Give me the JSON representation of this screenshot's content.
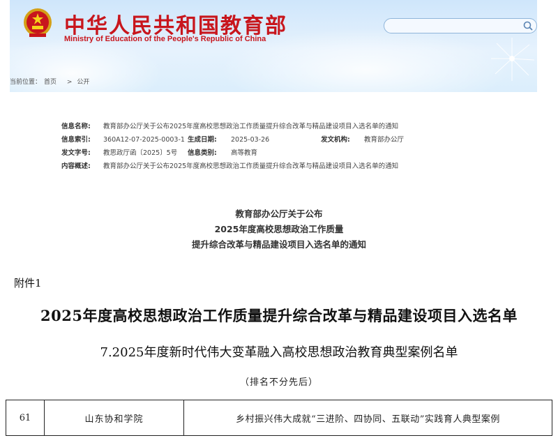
{
  "header": {
    "title": "中华人民共和国教育部",
    "subtitle": "Ministry of Education of the People's Republic of China",
    "search_placeholder": "",
    "breadcrumb": [
      "当前位置：",
      "首页",
      ">",
      "公开"
    ]
  },
  "info": {
    "name_label": "信息名称:",
    "name_value": "教育部办公厅关于公布2025年度高校思想政治工作质量提升综合改革与精品建设项目入选名单的通知",
    "index_label": "信息索引:",
    "index_value": "360A12-07-2025-0003-1",
    "date_label": "生成日期:",
    "date_value": "2025-03-26",
    "issuer_label": "发文机构:",
    "issuer_value": "教育部办公厅",
    "docno_label": "发文字号:",
    "docno_value": "教思政厅函〔2025〕5号",
    "category_label": "信息类别:",
    "category_value": "高等教育",
    "summary_label": "内容概述:",
    "summary_value": "教育部办公厅关于公布2025年度高校思想政治工作质量提升综合改革与精品建设项目入选名单的通知"
  },
  "notice": {
    "line1": "教育部办公厅关于公布",
    "line2": "2025年度高校思想政治工作质量",
    "line3": "提升综合改革与精品建设项目入选名单的通知"
  },
  "document": {
    "attachment": "附件1",
    "title": "2025年度高校思想政治工作质量提升综合改革与精品建设项目入选名单",
    "subtitle": "7.2025年度新时代伟大变革融入高校思想政治教育典型案例名单",
    "note": "（排名不分先后）"
  },
  "table": {
    "rows": [
      {
        "num": "61",
        "school": "山东协和学院",
        "case": "乡村振兴伟大成就“三进阶、四协同、五联动”实践育人典型案例"
      }
    ]
  },
  "colors": {
    "brand_red": "#c8161d",
    "header_blue": "#cfe6fb"
  }
}
